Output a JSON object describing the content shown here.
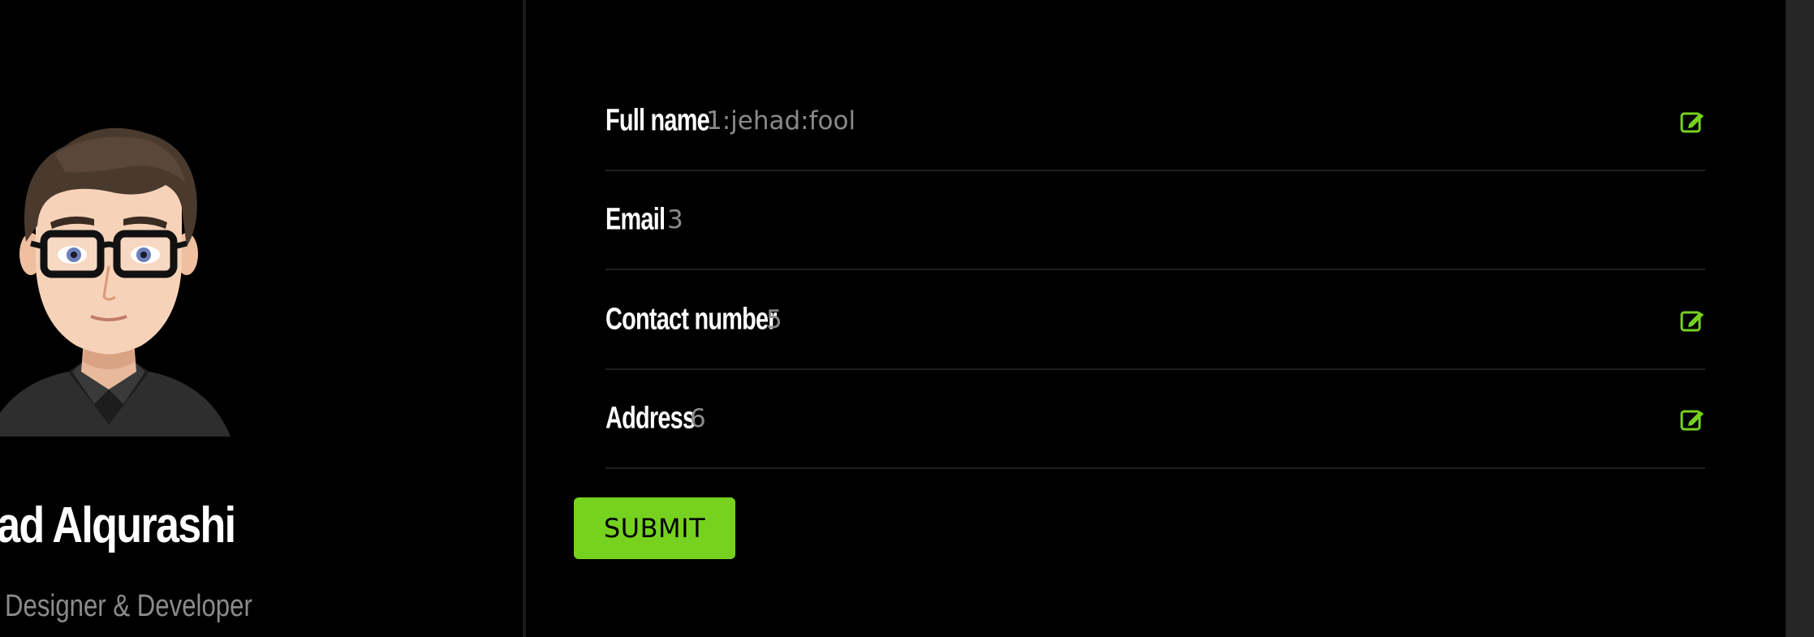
{
  "profile": {
    "name": "had Alqurashi",
    "role": "o Designer & Developer"
  },
  "fields": [
    {
      "label": "Full name",
      "value": "1:jehad:fool",
      "editable": true,
      "icon": "edit-icon"
    },
    {
      "label": "Email",
      "value": "3",
      "editable": false
    },
    {
      "label": "Contact number",
      "value": "5",
      "editable": true,
      "icon": "edit-icon"
    },
    {
      "label": "Address",
      "value": "6",
      "editable": true,
      "icon": "edit-icon"
    }
  ],
  "submit": {
    "label": "SUBMIT"
  },
  "colors": {
    "accent": "#76d21f",
    "background": "#000000",
    "label": "#ffffff",
    "value": "#8a8a8a",
    "divider": "#202020"
  }
}
